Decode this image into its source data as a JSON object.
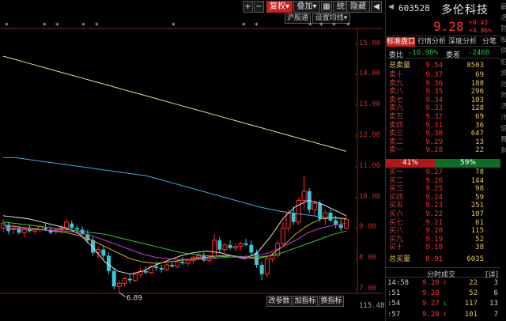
{
  "toolbar": {
    "plus": "+",
    "minus": "−",
    "fuquan": "复权",
    "fuquan_arrow": "▾",
    "diejia": "叠加",
    "diejia_arrow": "▾",
    "grid": "▦",
    "tongji": "统计",
    "yincang": "隐藏",
    "back": "◀",
    "forward": "▶",
    "sub_left": "沪股通",
    "sub_right": "设置均线",
    "sub_arrow": "▾"
  },
  "bottom_toolbar": {
    "gai_canshu": "改参数",
    "jia_zhibiao": "加指标",
    "huan_zhibiao": "换指标",
    "value": "115.48"
  },
  "chart_data": {
    "type": "candlestick",
    "price_axis": [
      "15.00",
      "14.00",
      "13.00",
      "12.00",
      "11.00",
      "10.00",
      "9.00",
      "8.00",
      "7.00"
    ],
    "ylim": [
      6.9,
      15.4
    ],
    "low_annotation": "6.89",
    "candles": [
      {
        "o": 9.0,
        "h": 9.3,
        "l": 8.85,
        "c": 9.15
      },
      {
        "o": 9.1,
        "h": 9.2,
        "l": 8.8,
        "c": 8.9
      },
      {
        "o": 8.95,
        "h": 9.1,
        "l": 8.8,
        "c": 9.0
      },
      {
        "o": 9.0,
        "h": 9.05,
        "l": 8.8,
        "c": 8.85
      },
      {
        "o": 8.85,
        "h": 9.0,
        "l": 8.7,
        "c": 8.95
      },
      {
        "o": 8.95,
        "h": 9.1,
        "l": 8.85,
        "c": 8.9
      },
      {
        "o": 8.9,
        "h": 9.0,
        "l": 8.8,
        "c": 8.95
      },
      {
        "o": 8.95,
        "h": 9.1,
        "l": 8.85,
        "c": 9.05
      },
      {
        "o": 9.0,
        "h": 9.15,
        "l": 8.9,
        "c": 8.95
      },
      {
        "o": 8.95,
        "h": 9.05,
        "l": 8.8,
        "c": 8.85
      },
      {
        "o": 8.9,
        "h": 9.0,
        "l": 8.8,
        "c": 8.95
      },
      {
        "o": 8.95,
        "h": 9.1,
        "l": 8.85,
        "c": 9.0
      },
      {
        "o": 9.0,
        "h": 9.3,
        "l": 8.9,
        "c": 9.2
      },
      {
        "o": 9.15,
        "h": 9.25,
        "l": 8.95,
        "c": 9.0
      },
      {
        "o": 9.0,
        "h": 9.1,
        "l": 8.85,
        "c": 8.95
      },
      {
        "o": 8.95,
        "h": 9.05,
        "l": 8.75,
        "c": 8.8
      },
      {
        "o": 8.8,
        "h": 8.95,
        "l": 8.5,
        "c": 8.6
      },
      {
        "o": 8.6,
        "h": 8.7,
        "l": 8.1,
        "c": 8.2
      },
      {
        "o": 8.2,
        "h": 8.4,
        "l": 8.0,
        "c": 8.3
      },
      {
        "o": 8.3,
        "h": 8.4,
        "l": 8.0,
        "c": 8.1
      },
      {
        "o": 8.1,
        "h": 8.2,
        "l": 7.5,
        "c": 7.6
      },
      {
        "o": 7.6,
        "h": 7.7,
        "l": 7.0,
        "c": 7.1
      },
      {
        "o": 7.1,
        "h": 7.3,
        "l": 6.89,
        "c": 7.2
      },
      {
        "o": 7.2,
        "h": 7.4,
        "l": 7.1,
        "c": 7.35
      },
      {
        "o": 7.35,
        "h": 7.5,
        "l": 7.2,
        "c": 7.3
      },
      {
        "o": 7.3,
        "h": 7.55,
        "l": 7.25,
        "c": 7.5
      },
      {
        "o": 7.5,
        "h": 7.7,
        "l": 7.4,
        "c": 7.6
      },
      {
        "o": 7.6,
        "h": 7.75,
        "l": 7.5,
        "c": 7.55
      },
      {
        "o": 7.55,
        "h": 7.8,
        "l": 7.5,
        "c": 7.75
      },
      {
        "o": 7.75,
        "h": 7.9,
        "l": 7.6,
        "c": 7.7
      },
      {
        "o": 7.7,
        "h": 7.8,
        "l": 7.55,
        "c": 7.65
      },
      {
        "o": 7.65,
        "h": 7.85,
        "l": 7.6,
        "c": 7.8
      },
      {
        "o": 7.8,
        "h": 7.9,
        "l": 7.7,
        "c": 7.75
      },
      {
        "o": 7.75,
        "h": 7.95,
        "l": 7.7,
        "c": 7.9
      },
      {
        "o": 7.9,
        "h": 8.05,
        "l": 7.8,
        "c": 7.85
      },
      {
        "o": 7.85,
        "h": 8.0,
        "l": 7.75,
        "c": 7.95
      },
      {
        "o": 7.95,
        "h": 8.1,
        "l": 7.85,
        "c": 8.05
      },
      {
        "o": 8.05,
        "h": 8.2,
        "l": 7.95,
        "c": 8.1
      },
      {
        "o": 8.1,
        "h": 8.2,
        "l": 7.9,
        "c": 7.95
      },
      {
        "o": 7.95,
        "h": 8.1,
        "l": 7.85,
        "c": 8.05
      },
      {
        "o": 8.05,
        "h": 8.8,
        "l": 8.0,
        "c": 8.6
      },
      {
        "o": 8.6,
        "h": 8.7,
        "l": 8.2,
        "c": 8.3
      },
      {
        "o": 8.3,
        "h": 8.5,
        "l": 8.2,
        "c": 8.45
      },
      {
        "o": 8.45,
        "h": 8.6,
        "l": 8.3,
        "c": 8.35
      },
      {
        "o": 8.35,
        "h": 8.5,
        "l": 8.25,
        "c": 8.4
      },
      {
        "o": 8.4,
        "h": 8.55,
        "l": 8.3,
        "c": 8.5
      },
      {
        "o": 8.5,
        "h": 8.65,
        "l": 8.4,
        "c": 8.45
      },
      {
        "o": 8.45,
        "h": 8.6,
        "l": 8.1,
        "c": 8.2
      },
      {
        "o": 8.2,
        "h": 8.3,
        "l": 7.7,
        "c": 7.8
      },
      {
        "o": 7.8,
        "h": 7.9,
        "l": 7.3,
        "c": 7.5
      },
      {
        "o": 7.5,
        "h": 8.1,
        "l": 7.4,
        "c": 8.0
      },
      {
        "o": 8.0,
        "h": 8.2,
        "l": 7.9,
        "c": 8.1
      },
      {
        "o": 8.1,
        "h": 8.6,
        "l": 8.05,
        "c": 8.5
      },
      {
        "o": 8.5,
        "h": 9.2,
        "l": 8.4,
        "c": 9.0
      },
      {
        "o": 9.0,
        "h": 9.6,
        "l": 8.9,
        "c": 9.5
      },
      {
        "o": 9.5,
        "h": 9.7,
        "l": 9.1,
        "c": 9.2
      },
      {
        "o": 9.2,
        "h": 10.0,
        "l": 9.1,
        "c": 9.9
      },
      {
        "o": 9.9,
        "h": 10.7,
        "l": 9.6,
        "c": 10.2
      },
      {
        "o": 10.2,
        "h": 10.3,
        "l": 9.5,
        "c": 9.6
      },
      {
        "o": 9.6,
        "h": 9.9,
        "l": 9.4,
        "c": 9.8
      },
      {
        "o": 9.8,
        "h": 9.9,
        "l": 9.2,
        "c": 9.3
      },
      {
        "o": 9.3,
        "h": 9.6,
        "l": 9.1,
        "c": 9.5
      },
      {
        "o": 9.5,
        "h": 9.6,
        "l": 9.2,
        "c": 9.25
      },
      {
        "o": 9.25,
        "h": 9.4,
        "l": 9.0,
        "c": 9.1
      },
      {
        "o": 9.1,
        "h": 9.3,
        "l": 8.9,
        "c": 9.0
      },
      {
        "o": 9.0,
        "h": 9.4,
        "l": 8.95,
        "c": 9.28
      }
    ],
    "moving_averages": [
      {
        "color": "#e8e08c",
        "values": [
          14.6,
          14.5,
          14.4,
          14.3,
          14.2,
          14.1,
          14.0,
          13.9,
          13.8,
          13.7,
          13.6,
          13.5,
          13.4,
          13.3,
          13.2,
          13.1,
          13.0,
          12.9,
          12.8,
          12.7,
          12.6,
          12.5,
          12.4,
          12.3,
          12.2,
          12.1,
          12.0,
          11.9,
          11.8,
          11.7,
          11.6,
          11.5
        ]
      },
      {
        "color": "#3aaee0",
        "values": [
          11.3,
          11.3,
          11.25,
          11.2,
          11.15,
          11.1,
          11.05,
          11.0,
          10.95,
          10.9,
          10.85,
          10.8,
          10.75,
          10.7,
          10.6,
          10.5,
          10.4,
          10.3,
          10.2,
          10.1,
          10.0,
          9.9,
          9.8,
          9.7,
          9.62,
          9.55,
          9.5,
          9.45,
          9.4,
          9.35,
          9.32,
          9.3
        ]
      },
      {
        "color": "#e0e0e0",
        "values": [
          9.4,
          9.35,
          9.3,
          9.2,
          9.1,
          9.0,
          8.8,
          8.4,
          7.9,
          7.6,
          7.5,
          7.6,
          7.8,
          7.95,
          8.1,
          8.2,
          8.25,
          8.2,
          8.1,
          8.0,
          8.2,
          8.7,
          9.3,
          9.7,
          9.9,
          9.8,
          9.6,
          9.4
        ]
      },
      {
        "color": "#d4b020",
        "values": [
          9.1,
          9.05,
          9.0,
          8.95,
          8.9,
          8.85,
          8.75,
          8.6,
          8.4,
          8.2,
          8.0,
          7.9,
          7.85,
          7.9,
          7.95,
          8.0,
          8.05,
          8.1,
          8.1,
          8.05,
          8.0,
          8.1,
          8.4,
          8.8,
          9.1,
          9.3,
          9.35,
          9.3
        ]
      },
      {
        "color": "#cc3cd0",
        "values": [
          9.0,
          8.98,
          8.96,
          8.94,
          8.92,
          8.9,
          8.85,
          8.75,
          8.6,
          8.45,
          8.3,
          8.15,
          8.05,
          8.0,
          7.98,
          7.98,
          8.0,
          8.03,
          8.06,
          8.08,
          8.1,
          8.2,
          8.4,
          8.6,
          8.85,
          9.0,
          9.1,
          9.15
        ]
      },
      {
        "color": "#40c040",
        "values": [
          9.2,
          9.15,
          9.1,
          9.05,
          9.0,
          8.95,
          8.9,
          8.85,
          8.8,
          8.7,
          8.6,
          8.5,
          8.4,
          8.3,
          8.2,
          8.15,
          8.1,
          8.08,
          8.06,
          8.05,
          8.05,
          8.1,
          8.2,
          8.35,
          8.5,
          8.65,
          8.8,
          8.9
        ]
      }
    ]
  },
  "panel": {
    "header": {
      "arrow": "◀",
      "code": "603528",
      "name": "多伦科技"
    },
    "price": "9.28",
    "change": "+0.43",
    "change_pct": "+4.86%",
    "tabs": [
      "标准盘口",
      "行情分析",
      "深度分析",
      "分笔"
    ],
    "wei_bi_label": "委比",
    "wei_bi": "-16.98%",
    "wei_cha_label": "委差",
    "wei_cha": "-2468",
    "sell_total": {
      "label": "总卖量",
      "price": "9.54",
      "vol": "8503"
    },
    "sells": [
      {
        "label": "卖十",
        "price": "9.37",
        "vol": "69"
      },
      {
        "label": "卖九",
        "price": "9.36",
        "vol": "188"
      },
      {
        "label": "卖八",
        "price": "9.35",
        "vol": "296"
      },
      {
        "label": "卖七",
        "price": "9.34",
        "vol": "103"
      },
      {
        "label": "卖六",
        "price": "9.33",
        "vol": "128"
      },
      {
        "label": "卖五",
        "price": "9.32",
        "vol": "69"
      },
      {
        "label": "卖四",
        "price": "9.31",
        "vol": "36"
      },
      {
        "label": "卖三",
        "price": "9.30",
        "vol": "647"
      },
      {
        "label": "卖二",
        "price": "9.29",
        "vol": "13"
      },
      {
        "label": "卖一",
        "price": "9.28",
        "vol": "22"
      }
    ],
    "ratio_buy": "41%",
    "ratio_sell": "59%",
    "buys": [
      {
        "label": "买一",
        "price": "9.27",
        "vol": "78"
      },
      {
        "label": "买二",
        "price": "9.26",
        "vol": "144"
      },
      {
        "label": "买三",
        "price": "9.25",
        "vol": "98"
      },
      {
        "label": "买四",
        "price": "9.24",
        "vol": "59"
      },
      {
        "label": "买五",
        "price": "9.23",
        "vol": "251"
      },
      {
        "label": "买六",
        "price": "9.22",
        "vol": "107"
      },
      {
        "label": "买七",
        "price": "9.21",
        "vol": "61"
      },
      {
        "label": "买八",
        "price": "9.20",
        "vol": "115"
      },
      {
        "label": "买九",
        "price": "9.19",
        "vol": "52"
      },
      {
        "label": "买十",
        "price": "9.18",
        "vol": "38"
      }
    ],
    "buy_total": {
      "label": "总买量",
      "price": "8.91",
      "vol": "6035"
    },
    "ticks_title": "分时成交",
    "ticks_detail": "[详]",
    "ticks": [
      {
        "time": "14:58",
        "price": "9.28",
        "arrow": "↑",
        "arrow_color": "#ff3030",
        "vol": "22",
        "num": "3"
      },
      {
        "time": ":51",
        "price": "9.28",
        "arrow": "",
        "arrow_color": "#ff3030",
        "vol": "52",
        "num": "6"
      },
      {
        "time": ":54",
        "price": "9.27",
        "arrow": "↓",
        "arrow_color": "#20c040",
        "vol": "117",
        "num": "13"
      },
      {
        "time": ":57",
        "price": "9.28",
        "arrow": "↑",
        "arrow_color": "#ff3030",
        "vol": "101",
        "num": "7"
      }
    ]
  },
  "edge_glyphs": [
    "最",
    "洛",
    "勍",
    "股",
    "佴",
    "伯",
    "资",
    "元",
    "外",
    "济",
    "汁",
    "值",
    "舞",
    "系"
  ]
}
